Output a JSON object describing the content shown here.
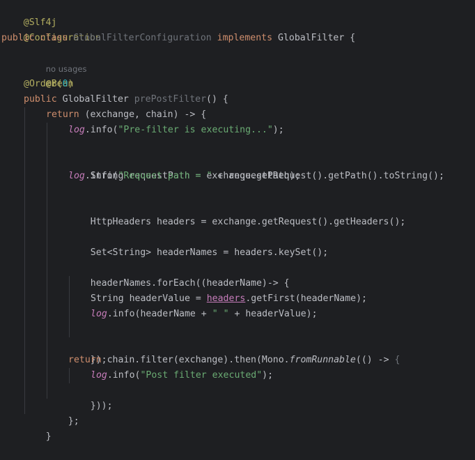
{
  "editor": {
    "usage_hint": "no usages",
    "tokens": {
      "t1": "@Slf4j",
      "t2": "@Configuration",
      "t3": "public class ",
      "t4": "GlobalFilterConfiguration",
      "t5": " implements ",
      "t6": "GlobalFilter {",
      "t7": "@Bean",
      "t8": "@Order(",
      "t9": "0",
      "t10": ")",
      "t11": "public ",
      "t12": "GlobalFilter ",
      "t13": "prePostFilter",
      "t14": "() {",
      "t15": "return",
      "t16": " (exchange, chain) -> {",
      "t17": "log",
      "t18": ".info(",
      "t19": "\"Pre-filter is executing...\"",
      "t20": ");",
      "t21": "String requestPath = exchange.getRequest().getPath().toString();",
      "t22": "log",
      "t23": ".info(",
      "t24": "\"Request path = \"",
      "t25": " + requestPath);",
      "t26": "HttpHeaders headers = exchange.getRequest().getHeaders();",
      "t27": "Set<String> headerNames = headers.keySet();",
      "t28": "headerNames.forEach((headerName)-> {",
      "t29": "String headerValue = ",
      "t30": "headers",
      "t31": ".getFirst(headerName);",
      "t32": "log",
      "t33": ".info(headerName + ",
      "t34": "\" \"",
      "t35": " + headerValue);",
      "t36": "});",
      "t37": "return",
      "t38": " chain.filter(exchange).then(Mono.",
      "t39": "fromRunnable",
      "t40": "(() -> ",
      "t41": "{",
      "t42": "log",
      "t43": ".info(",
      "t44": "\"Post filter executed\"",
      "t45": ");",
      "t46": "}));",
      "t47": "};",
      "t48": "}"
    }
  }
}
